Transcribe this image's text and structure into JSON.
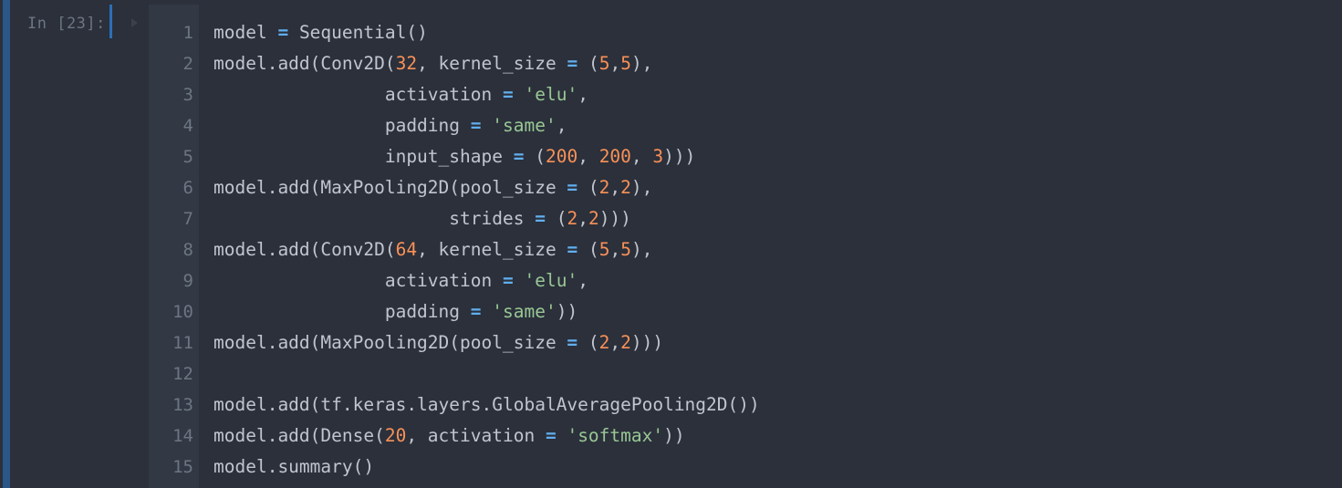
{
  "prompt": {
    "label": "In [23]:"
  },
  "cell": {
    "lines": [
      {
        "number": "1",
        "tokens": [
          [
            "t",
            "model "
          ],
          [
            "op",
            "="
          ],
          [
            "t",
            " Sequential()"
          ]
        ]
      },
      {
        "number": "2",
        "tokens": [
          [
            "t",
            "model.add(Conv2D("
          ],
          [
            "num",
            "32"
          ],
          [
            "t",
            ", kernel_size "
          ],
          [
            "op",
            "="
          ],
          [
            "t",
            " ("
          ],
          [
            "num",
            "5"
          ],
          [
            "t",
            ","
          ],
          [
            "num",
            "5"
          ],
          [
            "t",
            "),"
          ]
        ]
      },
      {
        "number": "3",
        "tokens": [
          [
            "t",
            "                activation "
          ],
          [
            "op",
            "="
          ],
          [
            "t",
            " "
          ],
          [
            "str",
            "'elu'"
          ],
          [
            "t",
            ","
          ]
        ]
      },
      {
        "number": "4",
        "tokens": [
          [
            "t",
            "                padding "
          ],
          [
            "op",
            "="
          ],
          [
            "t",
            " "
          ],
          [
            "str",
            "'same'"
          ],
          [
            "t",
            ","
          ]
        ]
      },
      {
        "number": "5",
        "tokens": [
          [
            "t",
            "                input_shape "
          ],
          [
            "op",
            "="
          ],
          [
            "t",
            " ("
          ],
          [
            "num",
            "200"
          ],
          [
            "t",
            ", "
          ],
          [
            "num",
            "200"
          ],
          [
            "t",
            ", "
          ],
          [
            "num",
            "3"
          ],
          [
            "t",
            ")))"
          ]
        ]
      },
      {
        "number": "6",
        "tokens": [
          [
            "t",
            "model.add(MaxPooling2D(pool_size "
          ],
          [
            "op",
            "="
          ],
          [
            "t",
            " ("
          ],
          [
            "num",
            "2"
          ],
          [
            "t",
            ","
          ],
          [
            "num",
            "2"
          ],
          [
            "t",
            "),"
          ]
        ]
      },
      {
        "number": "7",
        "tokens": [
          [
            "t",
            "                      strides "
          ],
          [
            "op",
            "="
          ],
          [
            "t",
            " ("
          ],
          [
            "num",
            "2"
          ],
          [
            "t",
            ","
          ],
          [
            "num",
            "2"
          ],
          [
            "t",
            ")))"
          ]
        ]
      },
      {
        "number": "8",
        "tokens": [
          [
            "t",
            "model.add(Conv2D("
          ],
          [
            "num",
            "64"
          ],
          [
            "t",
            ", kernel_size "
          ],
          [
            "op",
            "="
          ],
          [
            "t",
            " ("
          ],
          [
            "num",
            "5"
          ],
          [
            "t",
            ","
          ],
          [
            "num",
            "5"
          ],
          [
            "t",
            "),"
          ]
        ]
      },
      {
        "number": "9",
        "tokens": [
          [
            "t",
            "                activation "
          ],
          [
            "op",
            "="
          ],
          [
            "t",
            " "
          ],
          [
            "str",
            "'elu'"
          ],
          [
            "t",
            ","
          ]
        ]
      },
      {
        "number": "10",
        "tokens": [
          [
            "t",
            "                padding "
          ],
          [
            "op",
            "="
          ],
          [
            "t",
            " "
          ],
          [
            "str",
            "'same'"
          ],
          [
            "t",
            "))"
          ]
        ]
      },
      {
        "number": "11",
        "tokens": [
          [
            "t",
            "model.add(MaxPooling2D(pool_size "
          ],
          [
            "op",
            "="
          ],
          [
            "t",
            " ("
          ],
          [
            "num",
            "2"
          ],
          [
            "t",
            ","
          ],
          [
            "num",
            "2"
          ],
          [
            "t",
            ")))"
          ]
        ]
      },
      {
        "number": "12",
        "tokens": []
      },
      {
        "number": "13",
        "tokens": [
          [
            "t",
            "model.add(tf.keras.layers.GlobalAveragePooling2D())"
          ]
        ]
      },
      {
        "number": "14",
        "tokens": [
          [
            "t",
            "model.add(Dense("
          ],
          [
            "num",
            "20"
          ],
          [
            "t",
            ", activation "
          ],
          [
            "op",
            "="
          ],
          [
            "t",
            " "
          ],
          [
            "str",
            "'softmax'"
          ],
          [
            "t",
            "))"
          ]
        ]
      },
      {
        "number": "15",
        "tokens": [
          [
            "t",
            "model.summary()"
          ]
        ]
      }
    ]
  },
  "colors": {
    "background": "#2b303b",
    "gutter": "#323844",
    "selection_bar": "#2b5688",
    "operator": "#61afef",
    "number": "#f99157",
    "string": "#99c794",
    "text": "#c0c5ce"
  }
}
